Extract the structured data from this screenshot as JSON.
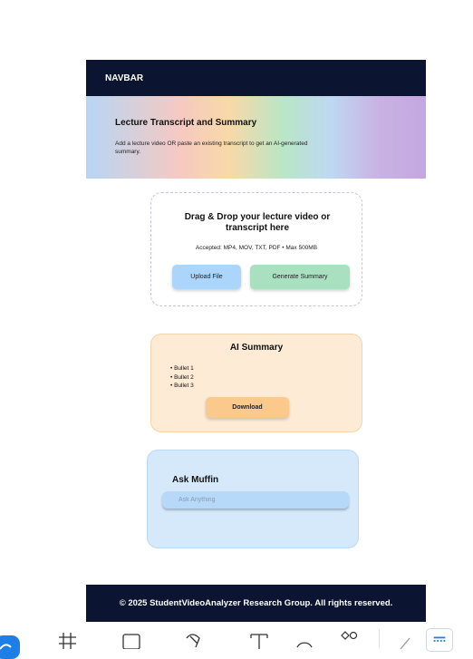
{
  "navbar": {
    "label": "NAVBAR"
  },
  "hero": {
    "title": "Lecture Transcript and Summary",
    "subtitle": "Add a lecture video OR paste an existing transcript to get an AI-generated summary."
  },
  "upload": {
    "title": "Drag & Drop your lecture video or transcript here",
    "accepted": "Accepted: MP4, MOV, TXT, PDF • Max 500MB",
    "upload_button": "Upload File",
    "generate_button": "Generate Summary"
  },
  "summary": {
    "title": "AI Summary",
    "bullets": [
      "Bullet 1",
      "Bullet 2",
      "Bullet 3"
    ],
    "download_button": "Download"
  },
  "ask": {
    "title": "Ask Muffin",
    "placeholder": "Ask Anything"
  },
  "footer": {
    "text": "© 2025 StudentVideoAnalyzer Research Group. All rights reserved."
  },
  "toolbar": {
    "tools": [
      "move-icon",
      "frame-icon",
      "rectangle-icon",
      "pen-icon",
      "text-icon",
      "comment-icon",
      "shapes-icon",
      "draw-icon",
      "ui-icon"
    ],
    "accent": "#1d7fe6"
  }
}
